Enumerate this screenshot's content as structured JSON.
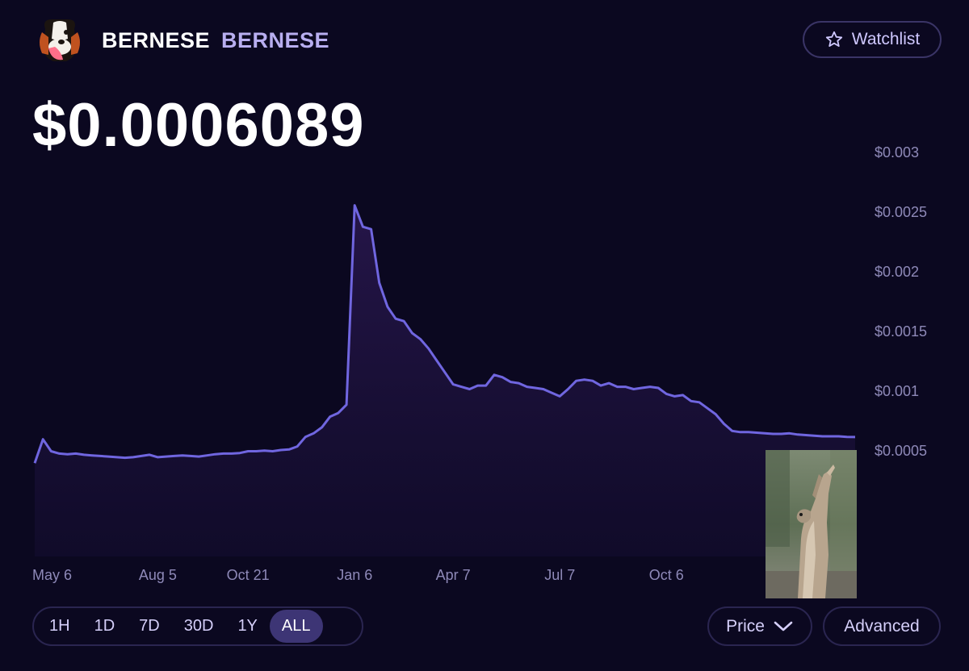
{
  "header": {
    "name": "BERNESE",
    "symbol": "BERNESE",
    "logo_icon": "bernese-dog-logo-icon",
    "watchlist_label": "Watchlist"
  },
  "price": "$0.0006089",
  "controls": {
    "ranges": [
      {
        "label": "1H",
        "active": false
      },
      {
        "label": "1D",
        "active": false
      },
      {
        "label": "7D",
        "active": false
      },
      {
        "label": "30D",
        "active": false
      },
      {
        "label": "1Y",
        "active": false
      },
      {
        "label": "ALL",
        "active": true
      }
    ],
    "metric_label": "Price",
    "advanced_label": "Advanced"
  },
  "colors": {
    "background": "#0b0820",
    "line": "#7066e0",
    "axis_text": "#8e89b8",
    "active_range": "#3d3575"
  },
  "chart_data": {
    "type": "area",
    "x_ticks": [
      "May 6",
      "Aug 5",
      "Oct 21",
      "Jan 6",
      "Apr 7",
      "Jul 7",
      "Oct 6"
    ],
    "y_ticks": [
      "$0.003",
      "$0.0025",
      "$0.002",
      "$0.0015",
      "$0.001",
      "$0.0005"
    ],
    "y_tick_values": [
      0.003,
      0.0025,
      0.002,
      0.0015,
      0.001,
      0.0005
    ],
    "ylim": [
      0,
      0.003
    ],
    "x_index_range": [
      0,
      100
    ],
    "x_tick_index": [
      0,
      15,
      26,
      39,
      51,
      64,
      77
    ],
    "grid": false,
    "series": [
      {
        "x": [
          0,
          1,
          2,
          3,
          4,
          5,
          6,
          7,
          8,
          9,
          10,
          11,
          12,
          13,
          14,
          15,
          16,
          17,
          18,
          19,
          20,
          21,
          22,
          23,
          24,
          25,
          26,
          27,
          28,
          29,
          30,
          31,
          32,
          33,
          34,
          35,
          36,
          37,
          38,
          39,
          40,
          41,
          42,
          43,
          44,
          45,
          46,
          47,
          48,
          49,
          50,
          51,
          52,
          53,
          54,
          55,
          56,
          57,
          58,
          59,
          60,
          61,
          62,
          63,
          64,
          65,
          66,
          67,
          68,
          69,
          70,
          71,
          72,
          73,
          74,
          75,
          76,
          77,
          78,
          79,
          80,
          81,
          82,
          83,
          84,
          85,
          86,
          87,
          88,
          89,
          90,
          91,
          92,
          93,
          94,
          95,
          96,
          97,
          98,
          99,
          100
        ],
        "values": [
          0.00039,
          0.00059,
          0.00049,
          0.00047,
          0.000465,
          0.00047,
          0.00046,
          0.000455,
          0.00045,
          0.000445,
          0.00044,
          0.000435,
          0.00044,
          0.00045,
          0.00046,
          0.00044,
          0.000445,
          0.00045,
          0.000455,
          0.00045,
          0.000445,
          0.000455,
          0.000465,
          0.00047,
          0.00047,
          0.000475,
          0.00049,
          0.00049,
          0.000495,
          0.00049,
          0.0005,
          0.000505,
          0.00053,
          0.00061,
          0.00064,
          0.00069,
          0.00078,
          0.00081,
          0.00088,
          0.00255,
          0.00237,
          0.00235,
          0.0019,
          0.0017,
          0.0016,
          0.00158,
          0.00148,
          0.00143,
          0.00135,
          0.00125,
          0.00115,
          0.00105,
          0.00103,
          0.00101,
          0.00104,
          0.00104,
          0.00113,
          0.00111,
          0.00107,
          0.00106,
          0.00103,
          0.00102,
          0.00101,
          0.00098,
          0.00095,
          0.00101,
          0.00108,
          0.00109,
          0.00108,
          0.00104,
          0.00106,
          0.00103,
          0.00103,
          0.00101,
          0.00102,
          0.00103,
          0.00102,
          0.00097,
          0.00095,
          0.00096,
          0.00091,
          0.0009,
          0.00085,
          0.0008,
          0.00072,
          0.00066,
          0.00065,
          0.00065,
          0.000645,
          0.00064,
          0.000635,
          0.000635,
          0.00064,
          0.00063,
          0.000625,
          0.00062,
          0.000615,
          0.000615,
          0.000615,
          0.00061,
          0.0006089
        ]
      }
    ]
  }
}
